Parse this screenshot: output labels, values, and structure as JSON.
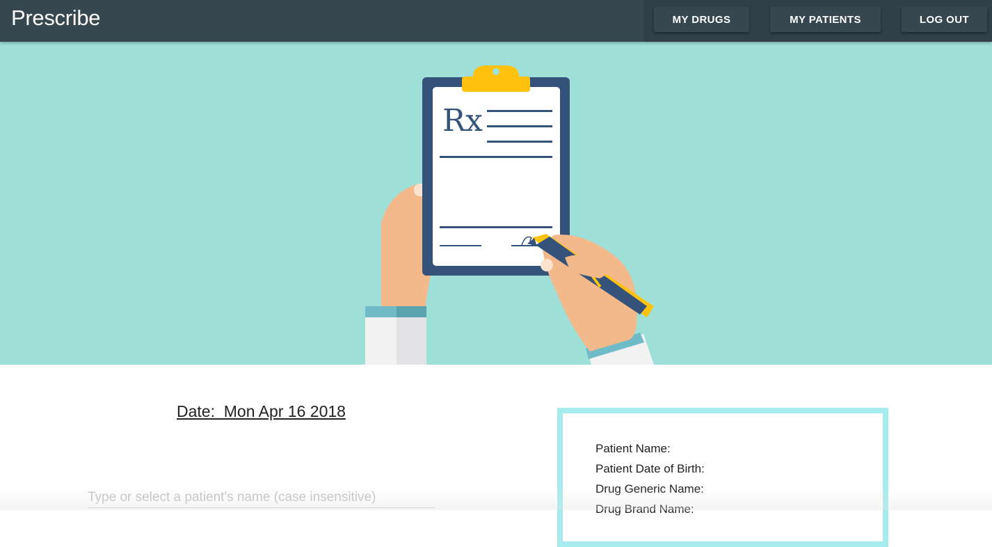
{
  "navbar": {
    "brand": "Prescribe",
    "buttons": {
      "my_drugs": "MY DRUGS",
      "my_patients": "MY PATIENTS",
      "log_out": "LOG OUT"
    }
  },
  "hero": {
    "illustration": "clipboard-prescription-illustration",
    "rx_symbol": "Rx"
  },
  "prescription": {
    "date_label": "Date:  Mon Apr 16 2018",
    "patient_search_placeholder": "Type or select a patient's name (case insensitive)"
  },
  "summary_card": {
    "fields": [
      "Patient Name:",
      "Patient Date of Birth:",
      "Drug Generic Name:",
      "Drug Brand Name:"
    ]
  },
  "colors": {
    "navbar": "#37474f",
    "hero_background": "#9ee0d8",
    "card_border": "#a6ecef"
  }
}
